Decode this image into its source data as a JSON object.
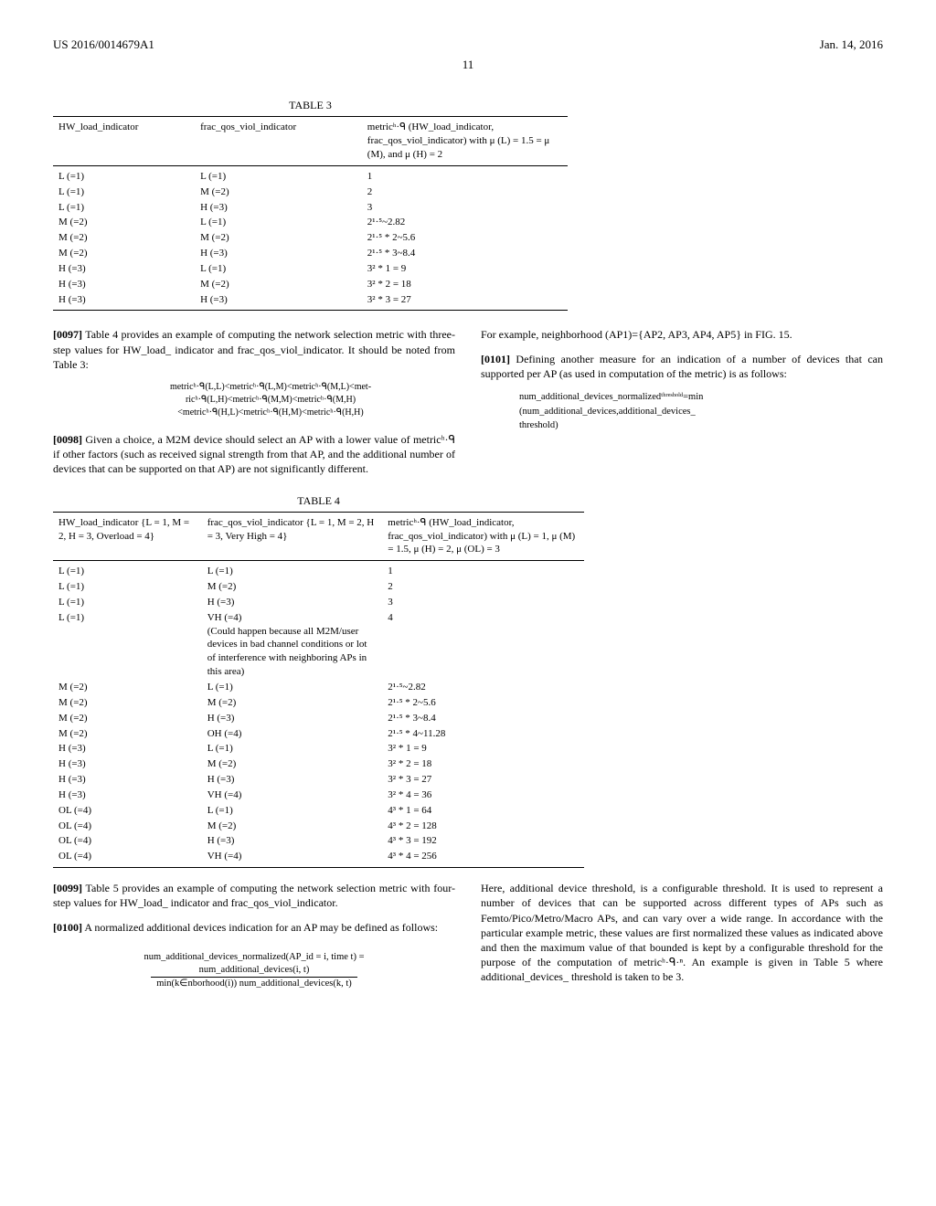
{
  "header": {
    "pub_number": "US 2016/0014679A1",
    "date": "Jan. 14, 2016",
    "page": "11"
  },
  "table3": {
    "caption": "TABLE 3",
    "head": {
      "c1": "HW_load_indicator",
      "c2": "frac_qos_viol_indicator",
      "c3": "metricʰ·ᑫ (HW_load_indicator, frac_qos_viol_indicator) with μ (L) = 1.5 = μ (M), and μ (H) = 2"
    },
    "rows": [
      {
        "c1": "L (=1)",
        "c2": "L (=1)",
        "c3": "1"
      },
      {
        "c1": "L (=1)",
        "c2": "M (=2)",
        "c3": "2"
      },
      {
        "c1": "L (=1)",
        "c2": "H (=3)",
        "c3": "3"
      },
      {
        "c1": "M (=2)",
        "c2": "L (=1)",
        "c3": "2¹·⁵~2.82"
      },
      {
        "c1": "M (=2)",
        "c2": "M (=2)",
        "c3": "2¹·⁵ * 2~5.6"
      },
      {
        "c1": "M (=2)",
        "c2": "H (=3)",
        "c3": "2¹·⁵ * 3~8.4"
      },
      {
        "c1": "H (=3)",
        "c2": "L (=1)",
        "c3": "3² * 1 = 9"
      },
      {
        "c1": "H (=3)",
        "c2": "M (=2)",
        "c3": "3² * 2 = 18"
      },
      {
        "c1": "H (=3)",
        "c2": "H (=3)",
        "c3": "3² * 3 = 27"
      }
    ]
  },
  "para97": {
    "label": "[0097]",
    "text": " Table 4 provides an example of computing the network selection metric with three-step values for HW_load_ indicator and frac_qos_viol_indicator. It should be noted from Table 3:"
  },
  "formula97": "metricʰ·ᑫ(L,L)<metricʰ·ᑫ(L,M)<metricʰ·ᑫ(M,L)<met-\nricʰ·ᑫ(L,H)<metricʰ·ᑫ(M,M)<metricʰ·ᑫ(M,H)\n<metricʰ·ᑫ(H,L)<metricʰ·ᑫ(H,M)<metricʰ·ᑫ(H,H)",
  "para98": {
    "label": "[0098]",
    "text": " Given a choice, a M2M device should select an AP with a lower value of metricʰ·ᑫ if other factors (such as received signal strength from that AP, and the additional number of devices that can be supported on that AP) are not significantly different."
  },
  "rightExample": "For example, neighborhood (AP1)={AP2, AP3, AP4, AP5} in FIG. 15.",
  "para101": {
    "label": "[0101]",
    "text": " Defining another measure for an indication of a number of devices that can supported per AP (as used in computation of the metric) is as follows:"
  },
  "formula101": "num_additional_devices_normalizedᵗʰʳᵉˢʰᵒˡᵈ=min\n(num_additional_devices,additional_devices_\nthreshold)",
  "table4": {
    "caption": "TABLE 4",
    "head": {
      "c1": "HW_load_indicator {L = 1, M = 2, H = 3, Overload = 4}",
      "c2": "frac_qos_viol_indicator {L = 1, M = 2, H = 3, Very High = 4}",
      "c3": "metricʰ·ᑫ (HW_load_indicator, frac_qos_viol_indicator) with μ (L) = 1, μ (M) = 1.5, μ (H) = 2, μ (OL) = 3"
    },
    "rows": [
      {
        "c1": "L (=1)",
        "c2": "L (=1)",
        "c3": "1"
      },
      {
        "c1": "L (=1)",
        "c2": "M (=2)",
        "c3": "2"
      },
      {
        "c1": "L (=1)",
        "c2": "H (=3)",
        "c3": "3"
      },
      {
        "c1": "L (=1)",
        "c2": "VH (=4)\n(Could happen because all M2M/user devices in bad channel conditions or lot of interference with neighboring APs in this area)",
        "c3": "4"
      },
      {
        "c1": "M (=2)",
        "c2": "L (=1)",
        "c3": "2¹·⁵~2.82"
      },
      {
        "c1": "M (=2)",
        "c2": "M (=2)",
        "c3": "2¹·⁵ * 2~5.6"
      },
      {
        "c1": "M (=2)",
        "c2": "H (=3)",
        "c3": "2¹·⁵ * 3~8.4"
      },
      {
        "c1": "M (=2)",
        "c2": "OH (=4)",
        "c3": "2¹·⁵ * 4~11.28"
      },
      {
        "c1": "H (=3)",
        "c2": "L (=1)",
        "c3": "3² * 1 = 9"
      },
      {
        "c1": "H (=3)",
        "c2": "M (=2)",
        "c3": "3² * 2 = 18"
      },
      {
        "c1": "H (=3)",
        "c2": "H (=3)",
        "c3": "3² * 3 = 27"
      },
      {
        "c1": "H (=3)",
        "c2": "VH (=4)",
        "c3": "3² * 4 = 36"
      },
      {
        "c1": "OL (=4)",
        "c2": "L (=1)",
        "c3": "4³ * 1 = 64"
      },
      {
        "c1": "OL (=4)",
        "c2": "M (=2)",
        "c3": "4³ * 2 = 128"
      },
      {
        "c1": "OL (=4)",
        "c2": "H (=3)",
        "c3": "4³ * 3 = 192"
      },
      {
        "c1": "OL (=4)",
        "c2": "VH (=4)",
        "c3": "4³ * 4 = 256"
      }
    ]
  },
  "para99": {
    "label": "[0099]",
    "text": " Table 5 provides an example of computing the network selection metric with four-step values for HW_load_ indicator and frac_qos_viol_indicator."
  },
  "para100": {
    "label": "[0100]",
    "text": " A normalized additional devices indication for an AP may be defined as follows:"
  },
  "formula100": {
    "lhs": "num_additional_devices_normalized(AP_id = i, time t) =",
    "num": "num_additional_devices(i, t)",
    "den": "min(k∈nborhood(i)) num_additional_devices(k, t)"
  },
  "rightBottom": "Here, additional device threshold, is a configurable threshold. It is used to represent a number of devices that can be supported across different types of APs such as Femto/Pico/Metro/Macro APs, and can vary over a wide range. In accordance with the particular example metric, these values are first normalized these values as indicated above and then the maximum value of that bounded is kept by a configurable threshold for the purpose of the computation of metricʰ·ᑫ·ⁿ. An example is given in Table 5 where additional_devices_ threshold is taken to be 3."
}
